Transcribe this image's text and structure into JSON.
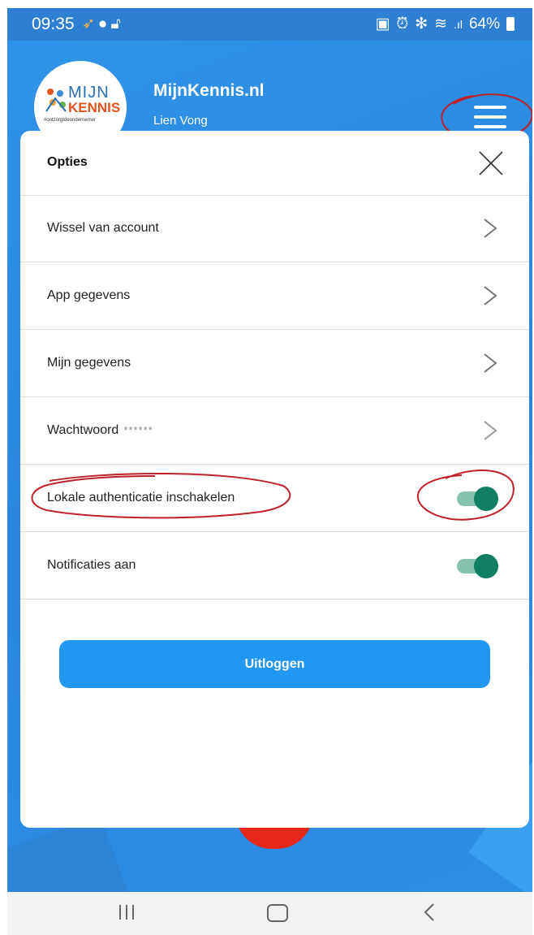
{
  "status_bar": {
    "time": "09:35",
    "left_icons": [
      "notification-icon",
      "chat-icon",
      "lock-icon"
    ],
    "battery": "64%"
  },
  "app": {
    "title": "MijnKennis.nl",
    "user_name": "Lien Vong",
    "logo": {
      "line1": "MIJN",
      "line2": "KENNIS",
      "tagline": "#ontzorgtdeondernemer"
    },
    "menu_icon": "hamburger-menu-icon"
  },
  "options_panel": {
    "title": "Opties",
    "close_icon": "close-icon",
    "rows": [
      {
        "label": "Wissel van account",
        "type": "chevron"
      },
      {
        "label": "App gegevens",
        "type": "chevron"
      },
      {
        "label": "Mijn gegevens",
        "type": "chevron"
      },
      {
        "label": "Wachtwoord",
        "suffix": "******",
        "type": "chevron"
      },
      {
        "label": "Lokale authenticatie inschakelen",
        "type": "toggle",
        "on": true
      },
      {
        "label": "Notificaties aan",
        "type": "toggle",
        "on": true
      }
    ],
    "logout_label": "Uitloggen"
  },
  "colors": {
    "primary_blue": "#2196f3",
    "app_background": "#2d8ee6",
    "toggle_on": "#0f7e63",
    "annotation_red": "#c0202a"
  },
  "nav_bar": {
    "icons": [
      "recent-apps-icon",
      "home-icon",
      "back-icon"
    ]
  }
}
